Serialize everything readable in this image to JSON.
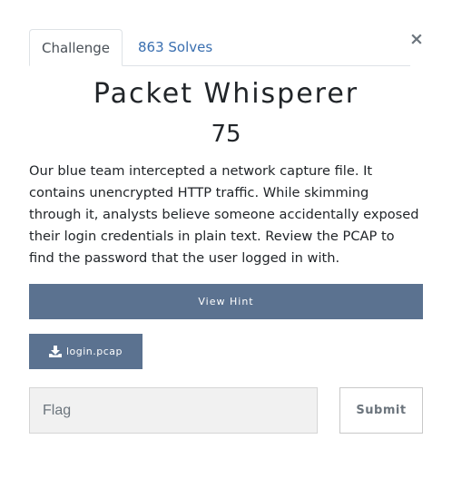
{
  "tabs": [
    {
      "label": "Challenge",
      "active": true
    },
    {
      "label": "863 Solves",
      "active": false
    }
  ],
  "close_icon": "×",
  "challenge": {
    "name": "Packet Whisperer",
    "points": "75",
    "description": "Our blue team intercepted a network capture file. It contains unencrypted HTTP traffic. While skimming through it, analysts believe someone accidentally exposed their login credentials in plain text. Review the PCAP to find the password that the user logged in with."
  },
  "hint_button": "View Hint",
  "file": {
    "name": "login.pcap",
    "icon": "download-icon"
  },
  "flag_input": {
    "placeholder": "Flag",
    "value": ""
  },
  "submit_label": "Submit",
  "colors": {
    "button_bg": "#5b7290",
    "link": "#3a6fb0"
  }
}
